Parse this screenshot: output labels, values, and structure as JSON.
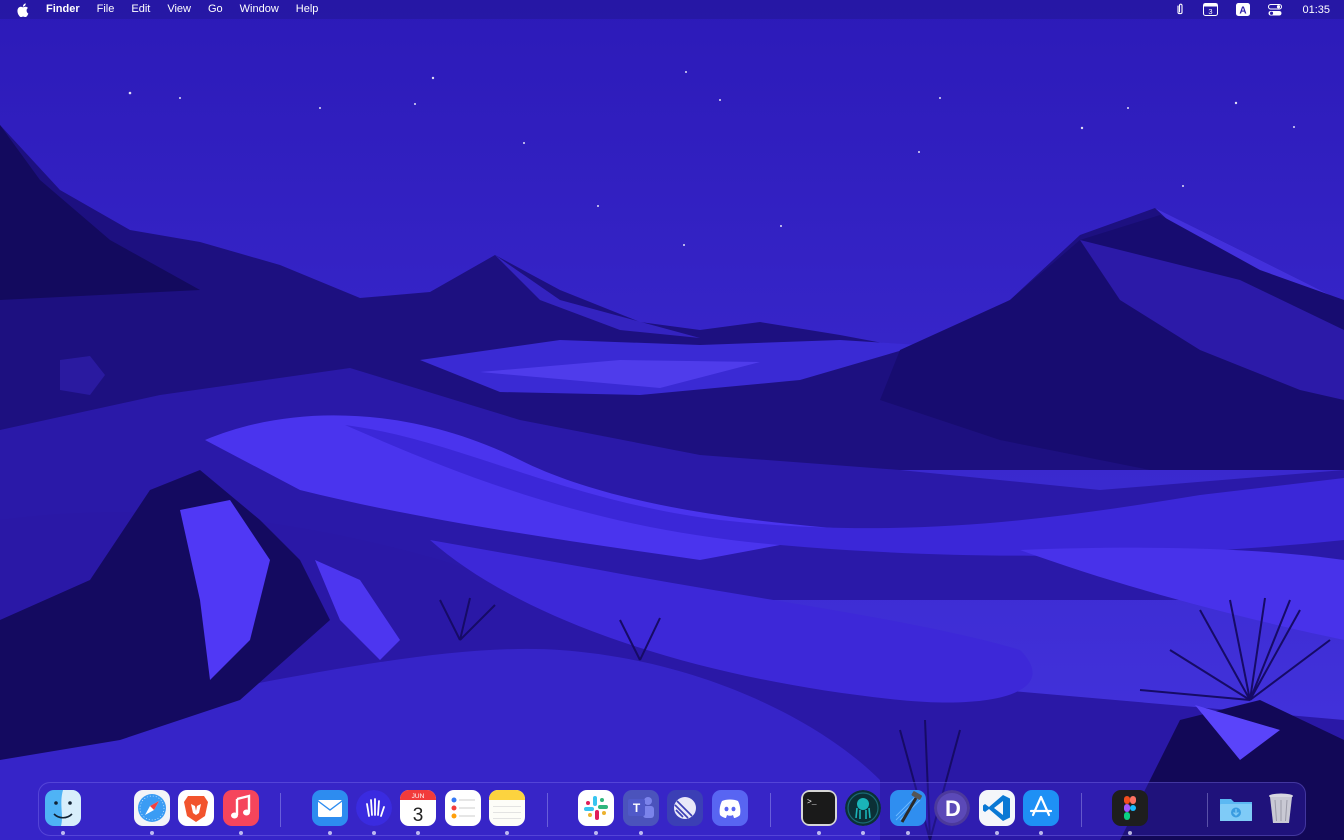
{
  "menubar": {
    "items": [
      "Finder",
      "File",
      "Edit",
      "View",
      "Go",
      "Window",
      "Help"
    ],
    "calendar_badge": "3",
    "input_source": "A",
    "clock": "01:35"
  },
  "dock": {
    "apps": [
      {
        "id": "finder",
        "icon": "finder-icon",
        "running": true
      },
      {
        "id": "safari",
        "icon": "safari-compass-icon",
        "running": true
      },
      {
        "id": "brave",
        "icon": "brave-lion-icon",
        "running": false
      },
      {
        "id": "music",
        "icon": "music-note-icon",
        "running": true
      },
      {
        "id": "mail",
        "icon": "mail-envelope-icon",
        "running": true
      },
      {
        "id": "raycast-hand",
        "icon": "waving-hand-icon",
        "running": true
      },
      {
        "id": "calendar",
        "icon": "calendar-icon",
        "running": true,
        "month": "JUN",
        "day": "3"
      },
      {
        "id": "reminders",
        "icon": "reminders-list-icon",
        "running": false
      },
      {
        "id": "notes",
        "icon": "notes-icon",
        "running": true
      },
      {
        "id": "slack",
        "icon": "slack-icon",
        "running": true
      },
      {
        "id": "teams",
        "icon": "teams-icon",
        "running": true,
        "letter": "T"
      },
      {
        "id": "linear",
        "icon": "linear-icon",
        "running": false
      },
      {
        "id": "discord",
        "icon": "discord-icon",
        "running": false
      },
      {
        "id": "terminal",
        "icon": "terminal-icon",
        "running": true,
        "prompt": ">_"
      },
      {
        "id": "gitkraken",
        "icon": "gitkraken-icon",
        "running": true
      },
      {
        "id": "xcode",
        "icon": "xcode-hammer-icon",
        "running": true
      },
      {
        "id": "dash",
        "icon": "dash-d-icon",
        "running": false,
        "letter": "D"
      },
      {
        "id": "vscode",
        "icon": "vscode-icon",
        "running": true
      },
      {
        "id": "appstore",
        "icon": "app-store-icon",
        "running": true
      },
      {
        "id": "figma",
        "icon": "figma-icon",
        "running": true
      },
      {
        "id": "downloads",
        "icon": "downloads-folder-icon",
        "running": false
      },
      {
        "id": "trash",
        "icon": "trash-icon",
        "running": false
      }
    ]
  },
  "colors": {
    "sky": "#3a2bd6",
    "mountain_dark": "#1a0f6e",
    "dune_light": "#4a32f0",
    "menubar_text": "#ffffff"
  }
}
